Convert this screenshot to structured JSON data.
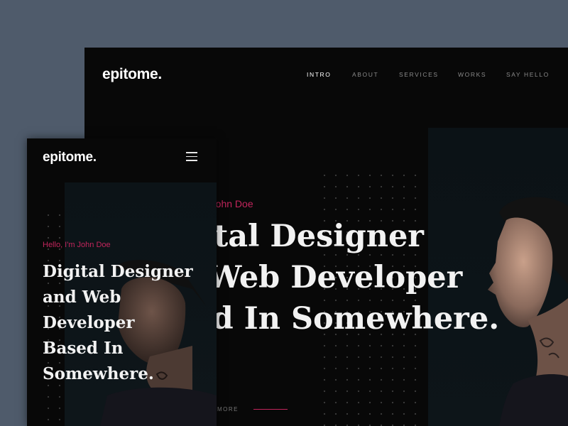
{
  "desktop": {
    "logo": "epitome.",
    "nav": [
      {
        "label": "INTRO",
        "active": true
      },
      {
        "label": "ABOUT",
        "active": false
      },
      {
        "label": "SERVICES",
        "active": false
      },
      {
        "label": "WORKS",
        "active": false
      },
      {
        "label": "SAY HELLO",
        "active": false
      }
    ],
    "greeting": "n John Doe",
    "headline": [
      "gital Designer",
      "d Web Developer",
      "sed In Somewhere."
    ],
    "more_label": "D MORE"
  },
  "mobile": {
    "logo": "epitome.",
    "greeting": "Hello, I'm John Doe",
    "headline": [
      "Digital Designer",
      "and Web",
      "Developer",
      "Based In",
      "Somewhere."
    ]
  },
  "colors": {
    "background": "#4f5b6b",
    "page": "#080808",
    "accent": "#c2255c",
    "text": "#f2f2f2",
    "nav_inactive": "#8a8a8a"
  },
  "icons": {
    "menu": "hamburger-menu-icon"
  }
}
